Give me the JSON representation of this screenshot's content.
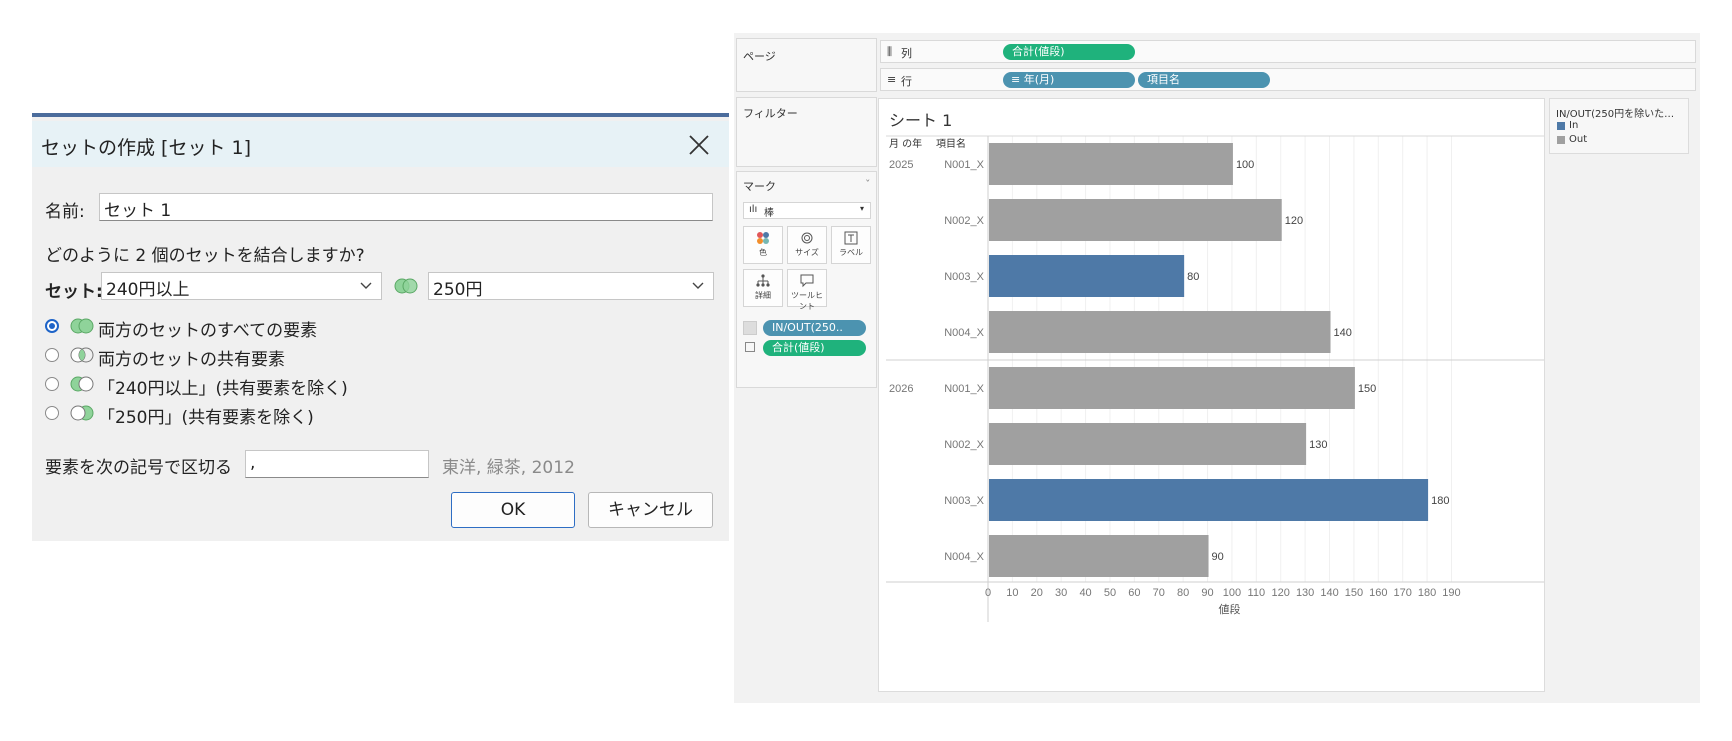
{
  "dialog": {
    "title": "セットの作成 [セット 1]",
    "name_label": "名前:",
    "name_value": "セット 1",
    "question": "どのように 2 個のセットを結合しますか?",
    "set_label": "セット:",
    "set_left": "240円以上",
    "set_right": "250円",
    "options": [
      {
        "label": "両方のセットのすべての要素",
        "checked": true
      },
      {
        "label": "両方のセットの共有要素",
        "checked": false
      },
      {
        "label": "「240円以上」(共有要素を除く)",
        "checked": false
      },
      {
        "label": "「250円」(共有要素を除く)",
        "checked": false
      }
    ],
    "separator_label": "要素を次の記号で区切る",
    "separator_value": ",",
    "separator_preview": "東洋, 緑茶, 2012",
    "ok_label": "OK",
    "cancel_label": "キャンセル",
    "accent_color": "#1e64c8",
    "venn_color": "#6cc47a"
  },
  "tableau": {
    "pages_label": "ページ",
    "columns_label": "列",
    "rows_label": "行",
    "column_pill": "合計(値段)",
    "row_pills": [
      "年(月)",
      "項目名"
    ],
    "filters_label": "フィルター",
    "marks_label": "マーク",
    "mark_type": "棒",
    "mark_buttons": [
      "色",
      "サイズ",
      "ラベル",
      "詳細",
      "ツールヒント"
    ],
    "mark_fields": [
      "IN/OUT(250..",
      "合計(値段)"
    ],
    "sheet_title": "シート 1",
    "header_year": "月 の年",
    "header_item": "項目名",
    "legend_title": "IN/OUT(250円を除いた…",
    "legend_items": [
      {
        "label": "In",
        "color": "#4e79a7"
      },
      {
        "label": "Out",
        "color": "#a0a0a0"
      }
    ]
  },
  "chart_data": {
    "type": "bar",
    "orientation": "horizontal",
    "title": "シート 1",
    "xlabel": "値段",
    "xlim": [
      0,
      198
    ],
    "x_ticks": [
      0,
      10,
      20,
      30,
      40,
      50,
      60,
      70,
      80,
      90,
      100,
      110,
      120,
      130,
      140,
      150,
      160,
      170,
      180,
      190
    ],
    "groups": [
      {
        "year": "2025",
        "bars": [
          {
            "item": "N001_X",
            "value": 100,
            "set": "Out"
          },
          {
            "item": "N002_X",
            "value": 120,
            "set": "Out"
          },
          {
            "item": "N003_X",
            "value": 80,
            "set": "In"
          },
          {
            "item": "N004_X",
            "value": 140,
            "set": "Out"
          }
        ]
      },
      {
        "year": "2026",
        "bars": [
          {
            "item": "N001_X",
            "value": 150,
            "set": "Out"
          },
          {
            "item": "N002_X",
            "value": 130,
            "set": "Out"
          },
          {
            "item": "N003_X",
            "value": 180,
            "set": "In"
          },
          {
            "item": "N004_X",
            "value": 90,
            "set": "Out"
          }
        ]
      }
    ],
    "colors": {
      "In": "#4e79a7",
      "Out": "#a0a0a0"
    },
    "grid": true,
    "legend": "right"
  }
}
